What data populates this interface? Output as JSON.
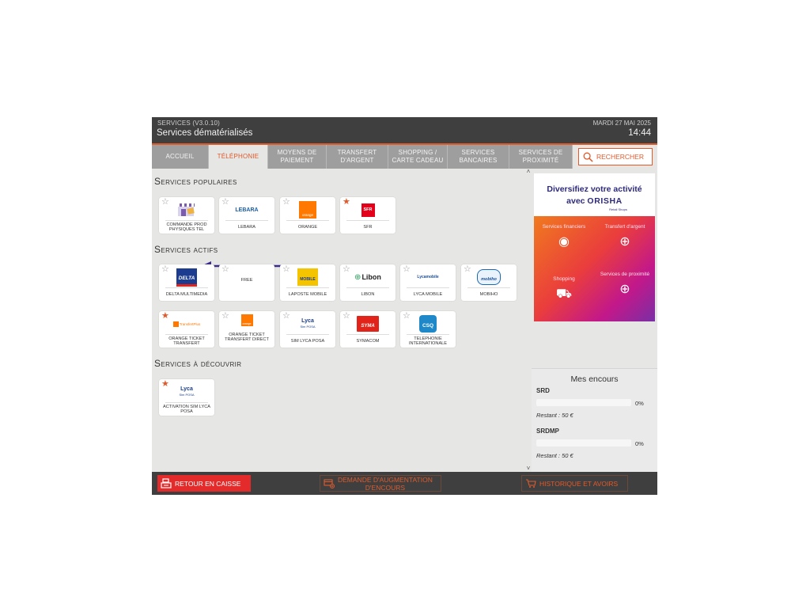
{
  "header": {
    "version": "SERVICES (V3.0.10)",
    "title": "Services dématérialisés",
    "date": "MARDI 27 MAI 2025",
    "time": "14:44"
  },
  "tabs": [
    {
      "label": "Accueil"
    },
    {
      "label": "Téléphonie",
      "active": true
    },
    {
      "label": "Moyens de paiement"
    },
    {
      "label": "Transfert d'argent"
    },
    {
      "label": "Shopping / Carte cadeau"
    },
    {
      "label": "Services bancaires"
    },
    {
      "label": "Services de proximité"
    }
  ],
  "search": {
    "label": "RECHERCHER",
    "icon": "search-icon"
  },
  "sections": {
    "popular": "Services populaires",
    "active": "Services actifs",
    "discover": "Services à découvrir"
  },
  "popular_tiles": [
    {
      "label": "COMMANDE PROD PHYSIQUES TEL",
      "logo": "",
      "starred": false
    },
    {
      "label": "LEBARA",
      "logo": "LEBARA",
      "starred": false
    },
    {
      "label": "ORANGE",
      "logo": "orange",
      "starred": false
    },
    {
      "label": "SFR",
      "logo": "SFR",
      "starred": true
    }
  ],
  "active_tiles": [
    {
      "label": "DELTA MULTIMEDIA",
      "logo": "DELTA",
      "starred": false
    },
    {
      "label": "FREE",
      "logo": "",
      "starred": false
    },
    {
      "label": "LAPOSTE MOBILE",
      "logo": "MOBILE",
      "starred": false
    },
    {
      "label": "LIBON",
      "logo": "Libon",
      "starred": false
    },
    {
      "label": "LYCA MOBILE",
      "logo": "Lycamobile",
      "starred": false
    },
    {
      "label": "MOBIHO",
      "logo": "mobiho",
      "starred": false
    },
    {
      "label": "ORANGE TICKET TRANSFERT",
      "logo": "TransfertPlus",
      "starred": true
    },
    {
      "label": "ORANGE TICKET TRANSFERT DIRECT",
      "logo": "orange",
      "starred": false
    },
    {
      "label": "SIM LYCA POSA",
      "logo": "Lyca",
      "logo_sub": "Sim POSA",
      "starred": false
    },
    {
      "label": "SYMACOM",
      "logo": "SYMA",
      "starred": false
    },
    {
      "label": "TELEPHONIE INTERNATIONALE",
      "logo": "CSQ",
      "starred": false
    }
  ],
  "discover_tiles": [
    {
      "label": "ACTIVATION SIM LYCA POSA",
      "logo": "Lyca",
      "logo_sub": "Sim POSA",
      "starred": true
    }
  ],
  "promo": {
    "line1": "Diversifiez votre activité",
    "line2_prefix": "avec",
    "brand": "ORISHA",
    "brand_sub": "Retail Shops",
    "cells": [
      {
        "label": "Services financiers",
        "icon": "coin-hand-icon"
      },
      {
        "label": "Transfert d'argent",
        "icon": "globe-icon"
      },
      {
        "label": "Shopping",
        "icon": "cart-icon"
      },
      {
        "label": "Services de proximité",
        "icon": "target-hand-icon"
      }
    ]
  },
  "encours": {
    "title": "Mes encours",
    "items": [
      {
        "name": "SRD",
        "percent": 0,
        "percent_label": "0%",
        "restant": "Restant : 50 €"
      },
      {
        "name": "SRDMP",
        "percent": 0,
        "percent_label": "0%",
        "restant": "Restant : 50 €"
      }
    ]
  },
  "footer": {
    "retour": "RETOUR EN CAISSE",
    "demande_line1": "DEMANDE D'AUGMENTATION",
    "demande_line2": "D'ENCOURS",
    "historique": "HISTORIQUE ET AVOIRS"
  },
  "colors": {
    "accent": "#e05a2b",
    "header_bg": "#3f3f3f",
    "primary_button": "#e32b2b",
    "brand_text": "#2d2a7a"
  }
}
